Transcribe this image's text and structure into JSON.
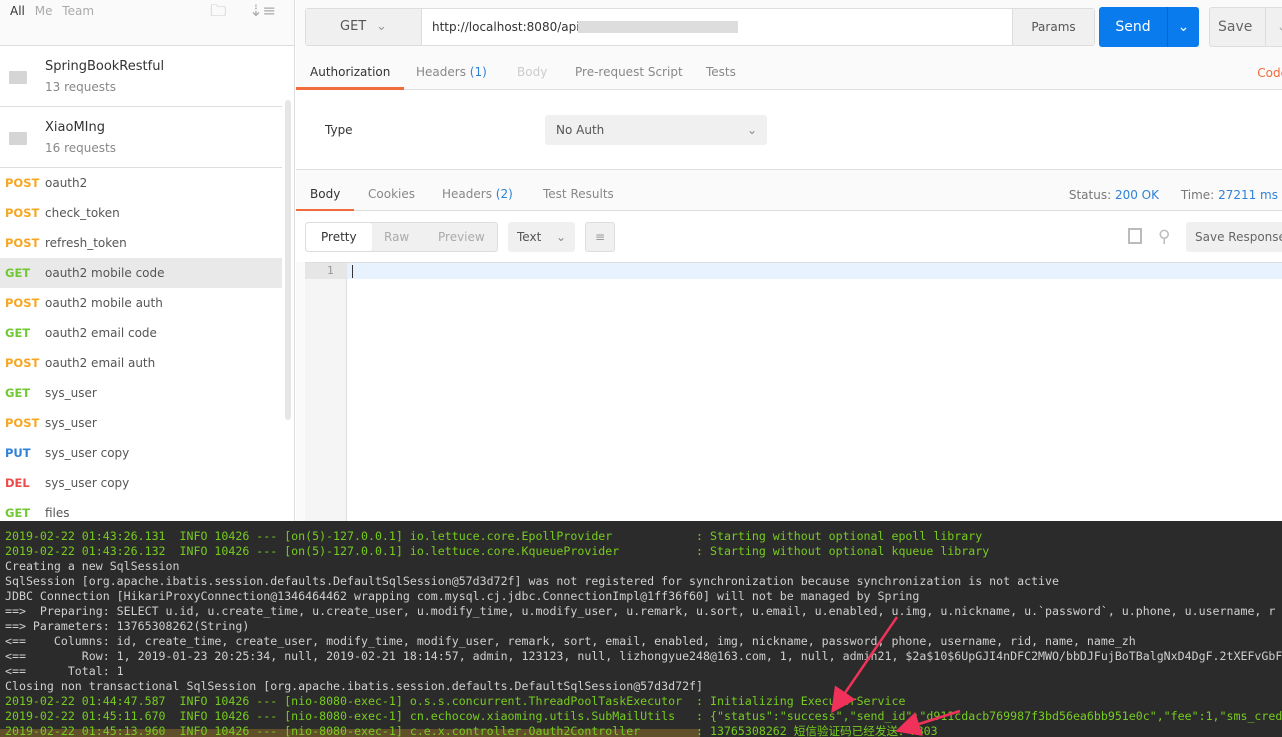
{
  "sidebar": {
    "tabs": [
      "All",
      "Me",
      "Team"
    ],
    "collections": [
      {
        "name": "SpringBookRestful",
        "count": "13 requests"
      },
      {
        "name": "XiaoMIng",
        "count": "16 requests"
      }
    ],
    "requests": [
      {
        "method": "POST",
        "name": "oauth2"
      },
      {
        "method": "POST",
        "name": "check_token"
      },
      {
        "method": "POST",
        "name": "refresh_token"
      },
      {
        "method": "GET",
        "name": "oauth2 mobile code",
        "selected": true
      },
      {
        "method": "POST",
        "name": "oauth2 mobile auth"
      },
      {
        "method": "GET",
        "name": "oauth2 email code"
      },
      {
        "method": "POST",
        "name": "oauth2 email auth"
      },
      {
        "method": "GET",
        "name": "sys_user"
      },
      {
        "method": "POST",
        "name": "sys_user"
      },
      {
        "method": "PUT",
        "name": "sys_user copy"
      },
      {
        "method": "DEL",
        "name": "sys_user copy"
      },
      {
        "method": "GET",
        "name": "files"
      }
    ]
  },
  "request": {
    "method": "GET",
    "url": "http://localhost:8080/api/auth/mobile/137",
    "params_label": "Params",
    "send_label": "Send",
    "save_label": "Save",
    "tabs": [
      {
        "label": "Authorization",
        "active": true
      },
      {
        "label": "Headers",
        "count": "(1)"
      },
      {
        "label": "Body",
        "disabled": true
      },
      {
        "label": "Pre-request Script"
      },
      {
        "label": "Tests"
      }
    ],
    "code_label": "Code",
    "auth_type_label": "Type",
    "auth_type_value": "No Auth"
  },
  "response": {
    "tabs": [
      {
        "label": "Body",
        "active": true
      },
      {
        "label": "Cookies"
      },
      {
        "label": "Headers",
        "count": "(2)"
      },
      {
        "label": "Test Results"
      }
    ],
    "status_label": "Status:",
    "status_value": "200 OK",
    "time_label": "Time:",
    "time_value": "27211 ms",
    "views": [
      "Pretty",
      "Raw",
      "Preview"
    ],
    "format": "Text",
    "save_response_label": "Save Response",
    "line_number": "1"
  },
  "console": {
    "colors": {
      "info": "#76cc1f",
      "plain": "#cfcfcf",
      "arrow": "#f0325a"
    },
    "lines": [
      {
        "c": "g",
        "t": "2019-02-22 01:43:26.131  INFO 10426 --- [on(5)-127.0.0.1] io.lettuce.core.EpollProvider            : Starting without optional epoll library"
      },
      {
        "c": "g",
        "t": "2019-02-22 01:43:26.132  INFO 10426 --- [on(5)-127.0.0.1] io.lettuce.core.KqueueProvider           : Starting without optional kqueue library"
      },
      {
        "c": "w",
        "t": "Creating a new SqlSession"
      },
      {
        "c": "w",
        "t": "SqlSession [org.apache.ibatis.session.defaults.DefaultSqlSession@57d3d72f] was not registered for synchronization because synchronization is not active"
      },
      {
        "c": "w",
        "t": "JDBC Connection [HikariProxyConnection@1346464462 wrapping com.mysql.cj.jdbc.ConnectionImpl@1ff36f60] will not be managed by Spring"
      },
      {
        "c": "w",
        "t": "==>  Preparing: SELECT u.id, u.create_time, u.create_user, u.modify_time, u.modify_user, u.remark, u.sort, u.email, u.enabled, u.img, u.nickname, u.`password`, u.phone, u.username, r"
      },
      {
        "c": "w",
        "t": "==> Parameters: 13765308262(String)"
      },
      {
        "c": "w",
        "t": "<==    Columns: id, create_time, create_user, modify_time, modify_user, remark, sort, email, enabled, img, nickname, password, phone, username, rid, name, name_zh"
      },
      {
        "c": "w",
        "t": "<==        Row: 1, 2019-01-23 20:25:34, null, 2019-02-21 18:14:57, admin, 123123, null, lizhongyue248@163.com, 1, null, admin21, $2a$10$6UpGJI4nDFC2MWO/bbDJFujBoTBalgNxD4DgF.2tXEFvGbF"
      },
      {
        "c": "w",
        "t": "<==      Total: 1"
      },
      {
        "c": "w",
        "t": "Closing non transactional SqlSession [org.apache.ibatis.session.defaults.DefaultSqlSession@57d3d72f]"
      },
      {
        "c": "g",
        "t": "2019-02-22 01:44:47.587  INFO 10426 --- [nio-8080-exec-1] o.s.s.concurrent.ThreadPoolTaskExecutor  : Initializing ExecutorService"
      },
      {
        "c": "g",
        "t": "2019-02-22 01:45:11.670  INFO 10426 --- [nio-8080-exec-1] cn.echocow.xiaoming.utils.SubMailUtils   : {\"status\":\"success\",\"send_id\":\"d911cdacb769987f3bd56ea6bb951e0c\",\"fee\":1,\"sms_cred"
      },
      {
        "c": "g",
        "t": "2019-02-22 01:45:13.960  INFO 10426 --- [nio-8080-exec-1] c.e.x.controller.Oauth2Controller        : 13765308262 短信验证码已经发送：7803"
      }
    ]
  }
}
